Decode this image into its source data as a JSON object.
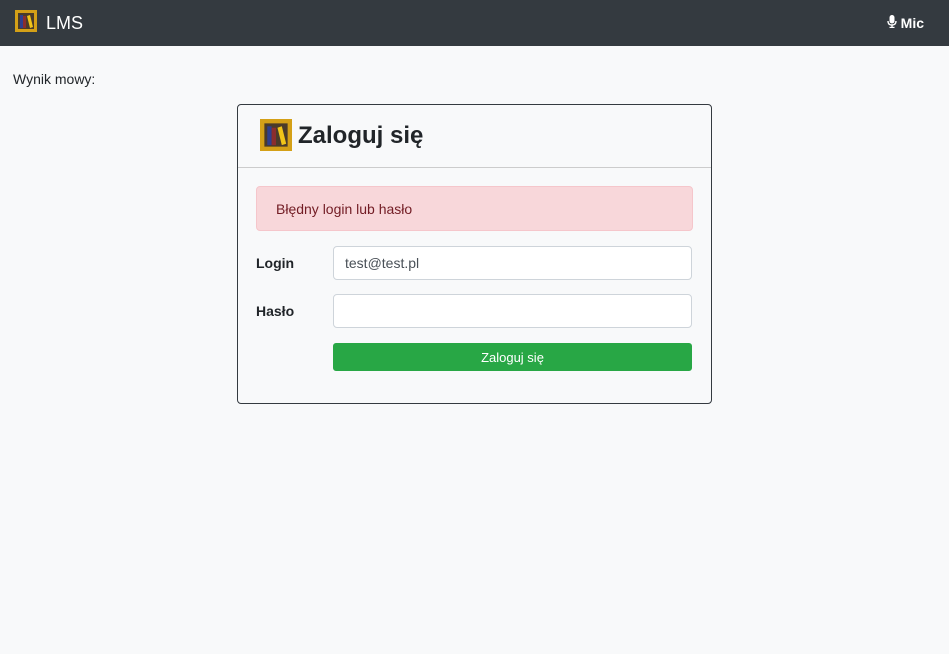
{
  "navbar": {
    "brand": "LMS",
    "mic_label": "Mic"
  },
  "speech": {
    "label": "Wynik mowy:",
    "result": ""
  },
  "login_card": {
    "title": "Zaloguj się",
    "alert": "Błędny login lub hasło",
    "login_label": "Login",
    "login_value": "test@test.pl",
    "password_label": "Hasło",
    "password_value": "",
    "submit_label": "Zaloguj się"
  },
  "colors": {
    "navbar_bg": "#343a40",
    "alert_bg": "#f8d7da",
    "alert_text": "#721c24",
    "submit_bg": "#28a745",
    "logo_gold": "#d4a017"
  }
}
